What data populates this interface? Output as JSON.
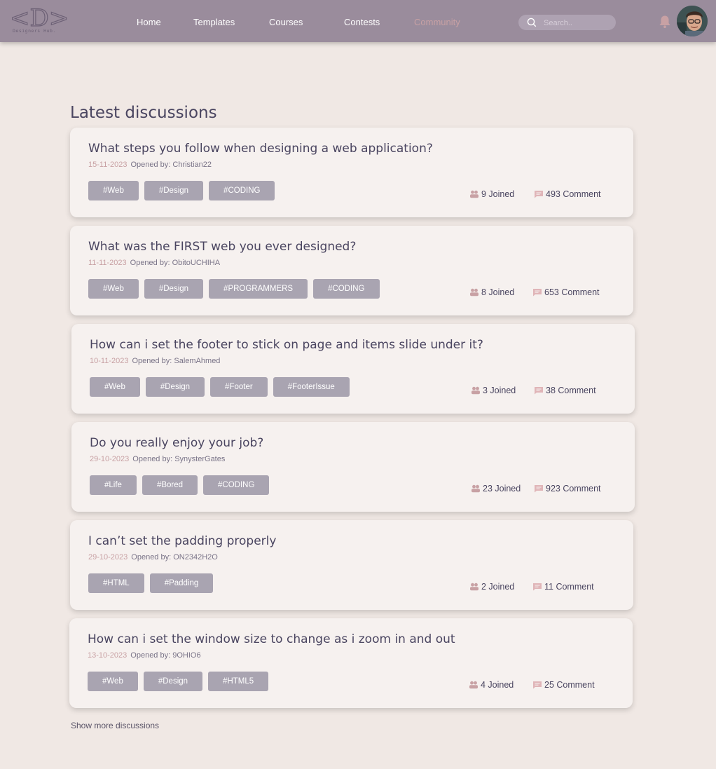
{
  "nav": {
    "logo_text": "<D>",
    "logo_subtext": "Designers Hub.",
    "links": [
      "Home",
      "Templates",
      "Courses",
      "Contests",
      "Community"
    ],
    "active_link": "Community",
    "search_placeholder": "Search..",
    "colors": {
      "bar": "#9a8c9c",
      "active": "#c8a1a4"
    }
  },
  "page_title": "Latest discussions",
  "discussions": [
    {
      "title": "What steps you follow when designing a web application?",
      "date": "15-11-2023",
      "opened_by_label": "Opened by:",
      "author": "Christian22",
      "tags": [
        "#Web",
        "#Design",
        "#CODING"
      ],
      "joined": "9 Joined",
      "comments": "493 Comment"
    },
    {
      "title": "What was the FIRST web you ever designed?",
      "date": "11-11-2023",
      "opened_by_label": "Opened by:",
      "author": "ObitoUCHIHA",
      "tags": [
        "#Web",
        "#Design",
        "#PROGRAMMERS",
        "#CODING"
      ],
      "joined": "8 Joined",
      "comments": "653 Comment"
    },
    {
      "title": "How can i set the footer to stick on page and items slide under it?",
      "date": "10-11-2023",
      "opened_by_label": "Opened by:",
      "author": "SalemAhmed",
      "tags": [
        "#Web",
        "#Design",
        "#Footer",
        "#FooterIssue"
      ],
      "joined": "3 Joined",
      "comments": "38 Comment"
    },
    {
      "title": "Do you really enjoy your job?",
      "date": "29-10-2023",
      "opened_by_label": "Opened by:",
      "author": "SynysterGates",
      "tags": [
        "#Life",
        "#Bored",
        "#CODING"
      ],
      "joined": "23 Joined",
      "comments": "923 Comment"
    },
    {
      "title": "I can’t set the padding properly",
      "date": "29-10-2023",
      "opened_by_label": "Opened by:",
      "author": "ON2342H2O",
      "tags": [
        "#HTML",
        "#Padding"
      ],
      "joined": "2 Joined",
      "comments": "11 Comment"
    },
    {
      "title": "How can i set the window size to change as i zoom in and out",
      "date": "13-10-2023",
      "opened_by_label": "Opened by:",
      "author": "9OHIO6",
      "tags": [
        "#Web",
        "#Design",
        "#HTML5"
      ],
      "joined": "4 Joined",
      "comments": "25 Comment"
    }
  ],
  "show_more_label": "Show more discussions",
  "icons": {
    "search": "search-icon",
    "bell": "bell-icon",
    "joined": "users-icon",
    "comments": "comment-icon"
  }
}
